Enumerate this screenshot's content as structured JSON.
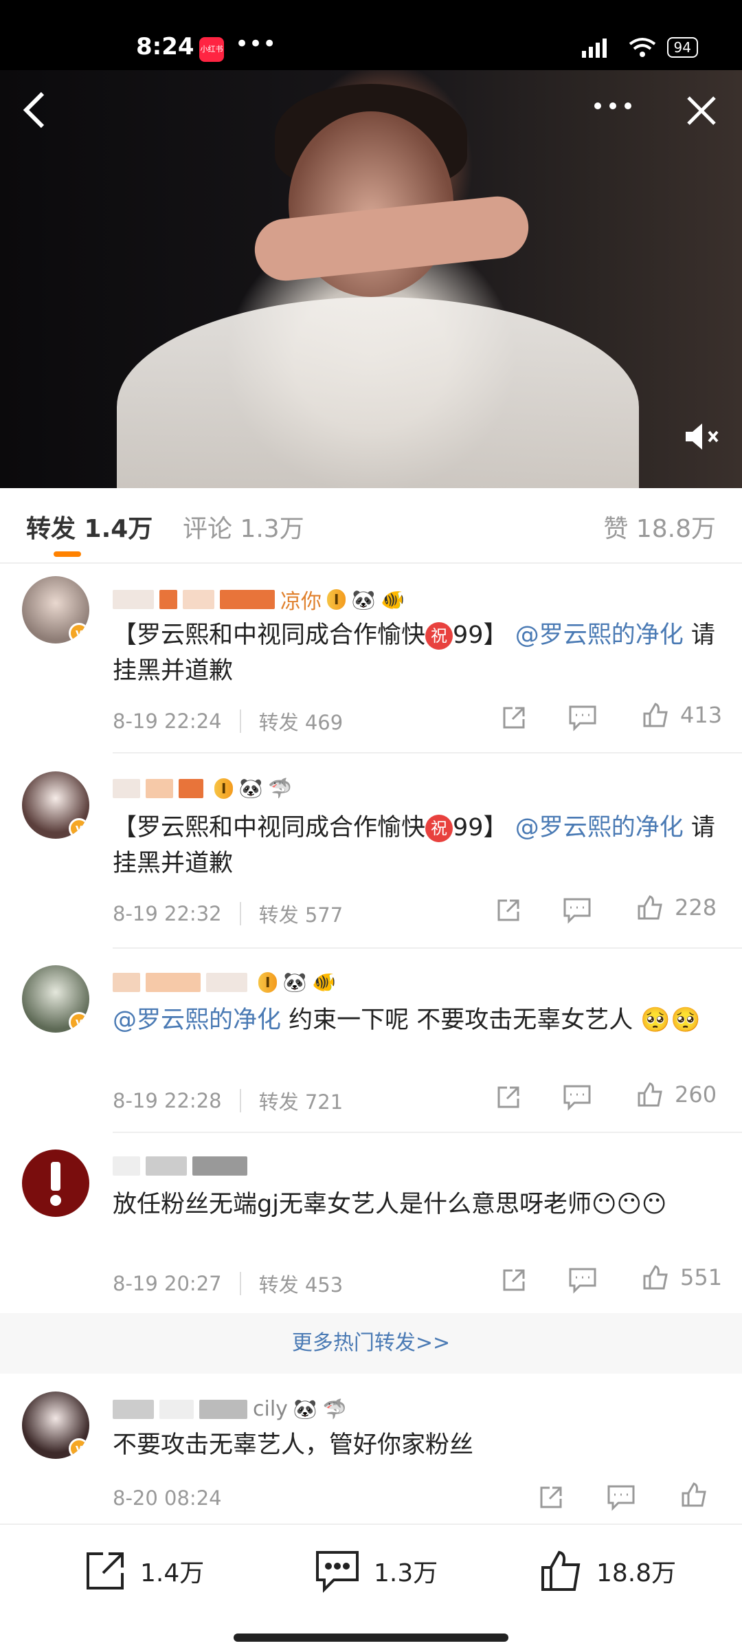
{
  "status": {
    "time": "8:24",
    "app_badge": "小红书",
    "dots": "•••",
    "battery": "94"
  },
  "tabs": {
    "repost": "转发 1.4万",
    "comment": "评论 1.3万",
    "like": "赞 18.8万"
  },
  "posts": [
    {
      "name_tail": "凉你",
      "level": "I",
      "content_a": "【罗云熙和中视同成合作愉快",
      "zhu": "祝",
      "content_b": "99】",
      "link": "@罗云熙的净化",
      "content_c": " 请挂黑并道歉",
      "time": "8-19 22:24",
      "repost": "转发 469",
      "likes": "413"
    },
    {
      "name_tail": "",
      "level": "I",
      "content_a": "【罗云熙和中视同成合作愉快",
      "zhu": "祝",
      "content_b": "99】",
      "link": "@罗云熙的净化",
      "content_c": " 请挂黑并道歉",
      "time": "8-19 22:32",
      "repost": "转发 577",
      "likes": "228"
    },
    {
      "name_tail": "",
      "level": "I",
      "link": "@罗云熙的净化",
      "content_c": " 约束一下呢  不要攻击无辜女艺人 ",
      "emoji": "🥺🥺",
      "time": "8-19 22:28",
      "repost": "转发 721",
      "likes": "260"
    },
    {
      "name_tail": "",
      "content_c": "放任粉丝无端gj无辜女艺人是什么意思呀老师",
      "emoji": "😶😶😶",
      "time": "8-19 20:27",
      "repost": "转发 453",
      "likes": "551"
    }
  ],
  "more_link": "更多热门转发>>",
  "latest": {
    "name_tail": "cily",
    "content": "不要攻击无辜艺人，管好你家粉丝",
    "time": "8-20 08:24"
  },
  "bottom": {
    "repost": "1.4万",
    "comment": "1.3万",
    "like": "18.8万"
  },
  "colors": {
    "accent": "#ff8200",
    "link": "#4a7ab4",
    "username": "#e0812e"
  }
}
